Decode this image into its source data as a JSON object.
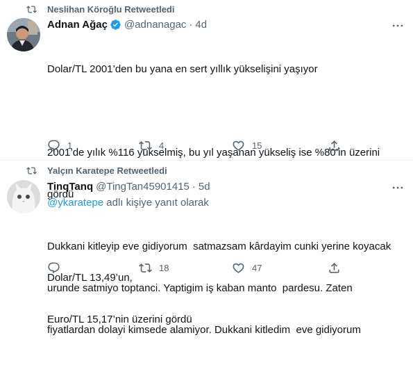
{
  "tweets": [
    {
      "retweeted_by": "Neslihan Köroğlu Retweetledi",
      "name": "Adnan Ağaç",
      "handle": "@adnanagac",
      "time": "4d",
      "text_lines": [
        "Dolar/TL 2001’den bu yana en sert yıllık yükselişini yaşıyor",
        "",
        "2001’de yılık %116 yükselmiş, bu yıl yaşanan yükseliş ise %80’in üzerini",
        "gördü",
        "",
        "Dolar/TL 13,49’un,",
        "Euro/TL 15,17’nin üzerini gördü"
      ],
      "replies": "1",
      "retweets": "4",
      "likes": "15"
    },
    {
      "retweeted_by": "Yalçın Karatepe Retweetledi",
      "name": "TinqTanq",
      "handle": "@TingTan45901415",
      "time": "5d",
      "reply_mention": "@ykaratepe",
      "reply_suffix": " adlı kişiye yanıt olarak",
      "text_lines": [
        "Dukkani kitleyip eve gidiyorum  satmazsam kârdayim cunki yerine koyacak",
        "urunde satmiyo toptanci. Yaptigim iş kaban manto  pardesu. Zaten",
        "fiyatlardan dolayi kimsede alamiyor. Dukkani kitledim  eve gidiyorum"
      ],
      "replies": "",
      "retweets": "18",
      "likes": "47"
    }
  ],
  "colors": {
    "accent": "#1d9bf0",
    "secondary_text": "#536471",
    "text": "#0f1419"
  },
  "icons": [
    "retweet-icon",
    "verified-badge-icon",
    "more-icon",
    "reply-icon",
    "like-icon",
    "share-icon"
  ]
}
